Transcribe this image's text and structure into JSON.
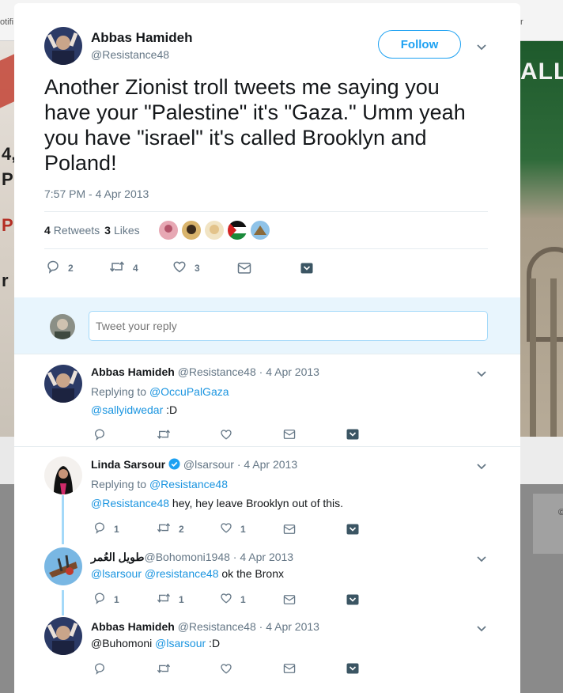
{
  "background": {
    "top_left_fragment": "otifi",
    "top_right_fragment": "r",
    "banner_fragment": "ALL",
    "left_glyphs": [
      "4,",
      "P",
      "P",
      "r"
    ],
    "copyright_fragment": "©"
  },
  "main_tweet": {
    "author_name": "Abbas Hamideh",
    "author_handle": "@Resistance48",
    "follow_label": "Follow",
    "text": "Another Zionist troll tweets me saying you have your \"Palestine\" it's \"Gaza.\" Umm yeah you have \"israel\" it's called Brooklyn and Poland!",
    "timestamp": "7:57 PM - 4 Apr 2013",
    "retweets_count": "4",
    "retweets_label": "Retweets",
    "likes_count": "3",
    "likes_label": "Likes",
    "reply_count": "2",
    "retweet_action_count": "4",
    "like_action_count": "3"
  },
  "reply_box": {
    "placeholder": "Tweet your reply"
  },
  "replies": [
    {
      "name": "Abbas Hamideh",
      "handle": "@Resistance48",
      "date": "4 Apr 2013",
      "replying_label": "Replying to",
      "replying_to": "@OccuPalGaza",
      "mention": "@sallyidwedar",
      "text": " :D"
    },
    {
      "name": "Linda Sarsour",
      "handle": "@lsarsour",
      "date": "4 Apr 2013",
      "replying_label": "Replying to",
      "replying_to": "@Resistance48",
      "mention": "@Resistance48",
      "text": " hey, hey leave Brooklyn out of this.",
      "reply_count": "1",
      "retweet_count": "2",
      "like_count": "1"
    },
    {
      "name": "طويل العُمر",
      "handle": "@Bohomoni1948",
      "date": "4 Apr 2013",
      "mention": "@lsarsour @resistance48",
      "text": " ok the Bronx",
      "reply_count": "1",
      "retweet_count": "1",
      "like_count": "1"
    },
    {
      "name": "Abbas Hamideh",
      "handle": "@Resistance48",
      "date": "4 Apr 2013",
      "prefix": "@Buhomoni ",
      "mention": "@lsarsour",
      "text": " :D"
    }
  ],
  "date_separator": " · ",
  "colors": {
    "accent": "#1da1f2",
    "link": "#1b95e0",
    "muted": "#657786",
    "reply_box_bg": "#e8f5fd"
  },
  "icons": [
    "reply-icon",
    "retweet-icon",
    "like-icon",
    "dm-icon",
    "bookmark-icon",
    "caret-down-icon",
    "verified-icon"
  ]
}
